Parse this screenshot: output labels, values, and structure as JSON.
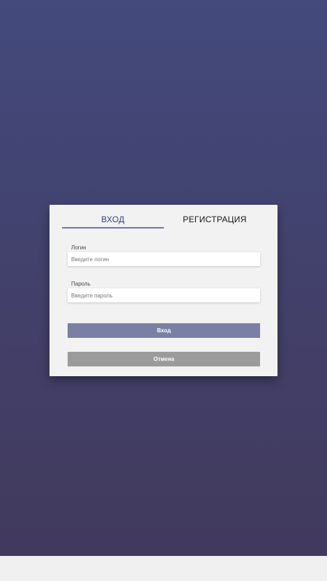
{
  "tabs": {
    "login": "ВХОД",
    "register": "РЕГИСТРАЦИЯ"
  },
  "form": {
    "login_label": "Логин",
    "login_placeholder": "Введите логин",
    "password_label": "Пароль",
    "password_placeholder": "Введите пароль",
    "submit_label": "Вход",
    "cancel_label": "Отмена"
  }
}
